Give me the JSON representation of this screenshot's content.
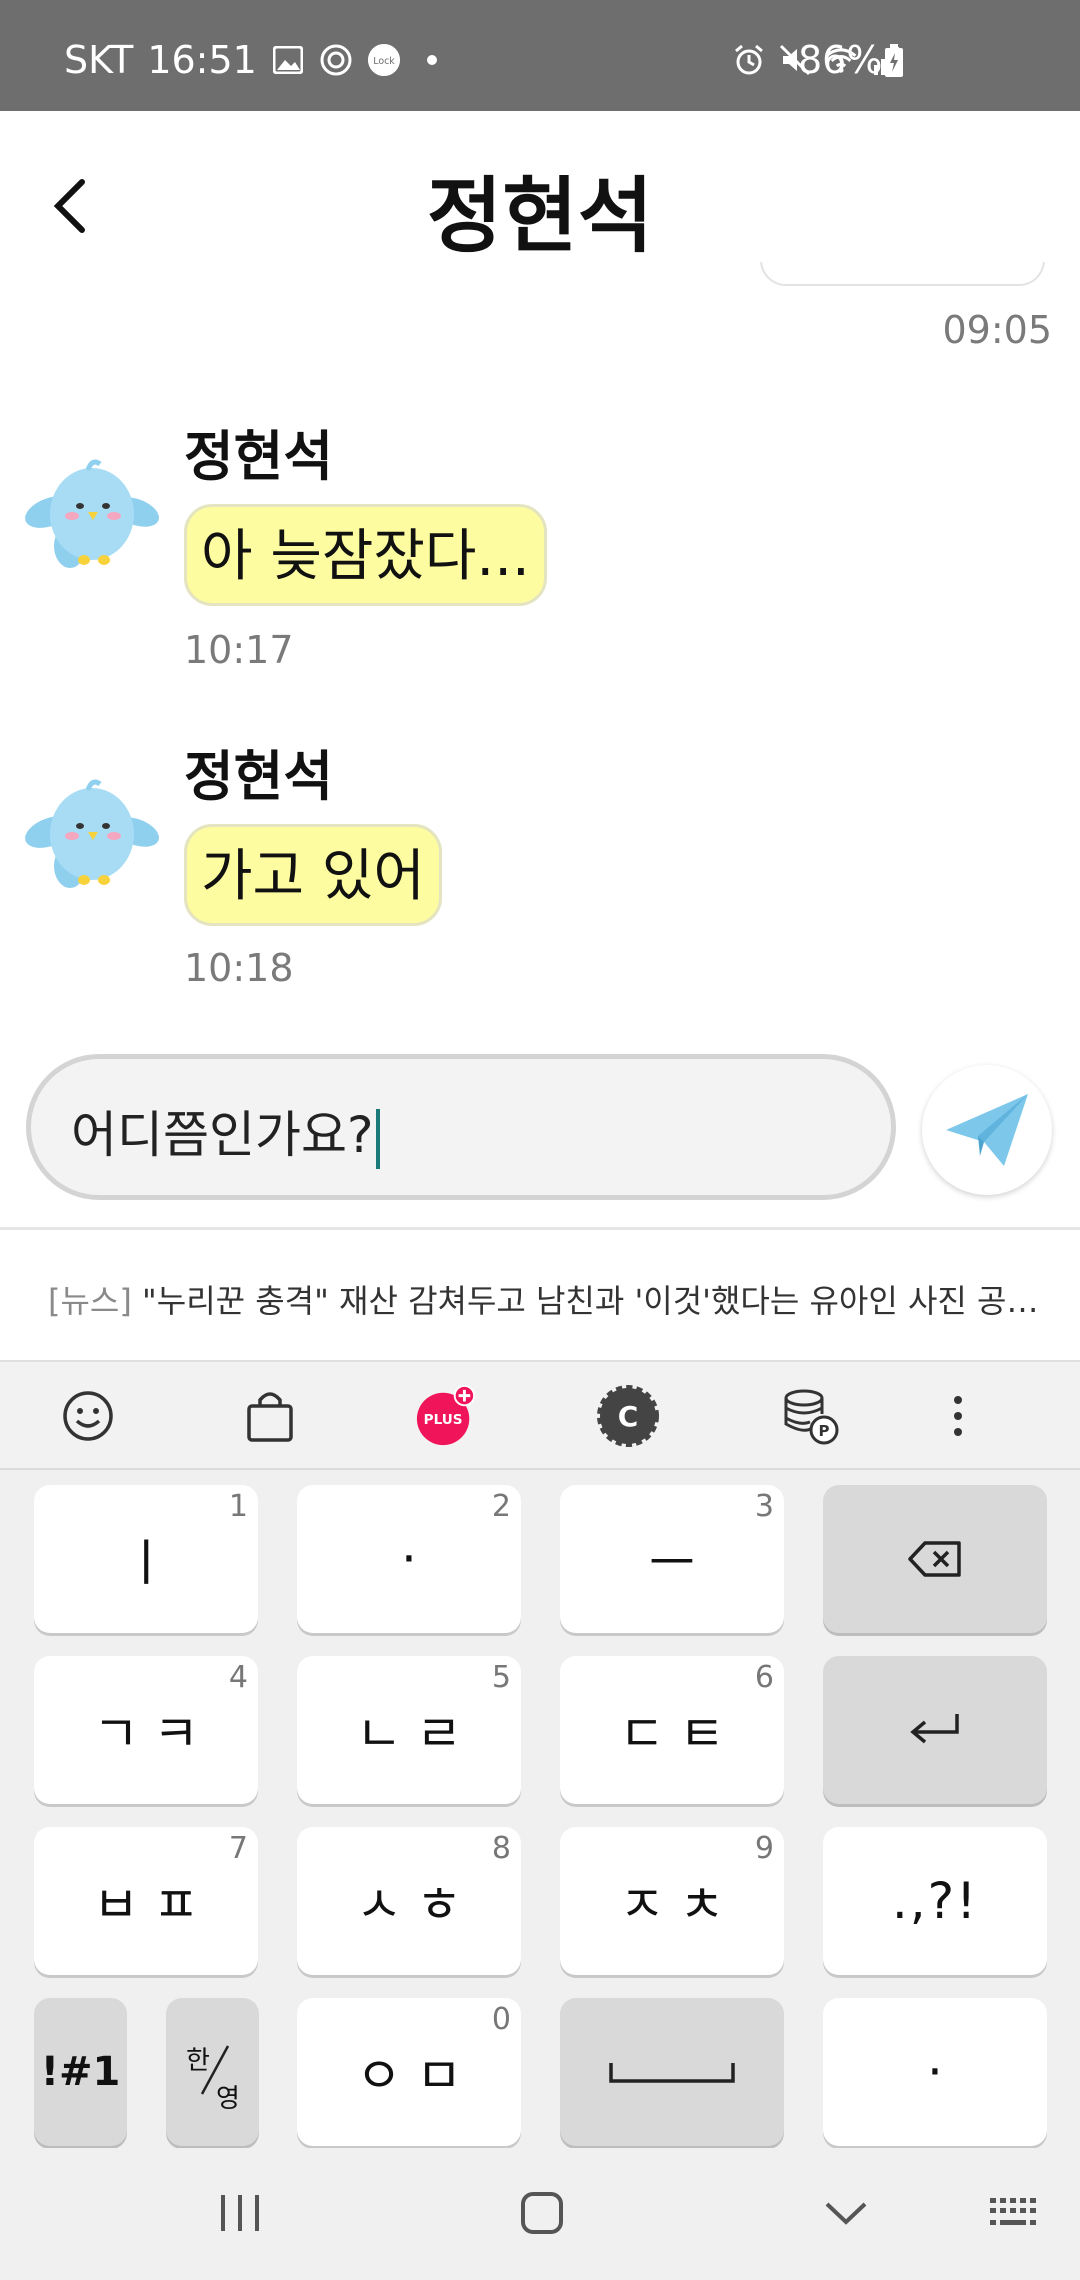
{
  "status_bar": {
    "carrier": "SKT",
    "time": "16:51",
    "battery": "86%"
  },
  "header": {
    "title": "정현석"
  },
  "messages": [
    {
      "time": "09:05"
    },
    {
      "sender": "정현석",
      "text": "아 늦잠잤다...",
      "time": "10:17"
    },
    {
      "sender": "정현석",
      "text": "가고 있어",
      "time": "10:18"
    }
  ],
  "input": {
    "value": "어디쯤인가요?"
  },
  "news": {
    "tag": "[뉴스]",
    "text": "\"누리꾼 충격\" 재산 감쳐두고 남친과 '이것'했다는 유아인 사진 공개..."
  },
  "keyboard_toolbar": {
    "plus_label": "PLUS",
    "c_label": "C"
  },
  "keyboard": {
    "row1": [
      {
        "label": "ㅣ",
        "num": "1"
      },
      {
        "label": "·",
        "num": "2"
      },
      {
        "label": "ㅡ",
        "num": "3"
      }
    ],
    "row2": [
      {
        "label": "ㄱㅋ",
        "num": "4"
      },
      {
        "label": "ㄴㄹ",
        "num": "5"
      },
      {
        "label": "ㄷㅌ",
        "num": "6"
      }
    ],
    "row3": [
      {
        "label": "ㅂㅍ",
        "num": "7"
      },
      {
        "label": "ㅅㅎ",
        "num": "8"
      },
      {
        "label": "ㅈㅊ",
        "num": "9"
      },
      {
        "label": ".,?!"
      }
    ],
    "row4": [
      {
        "label": "!#1"
      },
      {
        "label_top": "한",
        "label_bottom": "영"
      },
      {
        "label": "ㅇㅁ",
        "num": "0"
      },
      {
        "label": "·"
      }
    ]
  },
  "colors": {
    "status_bar_bg": "#6e6e6e",
    "bubble_bg": "#fdfca0",
    "send_icon": "#7cc7ea",
    "plus_badge": "#f0155a"
  }
}
